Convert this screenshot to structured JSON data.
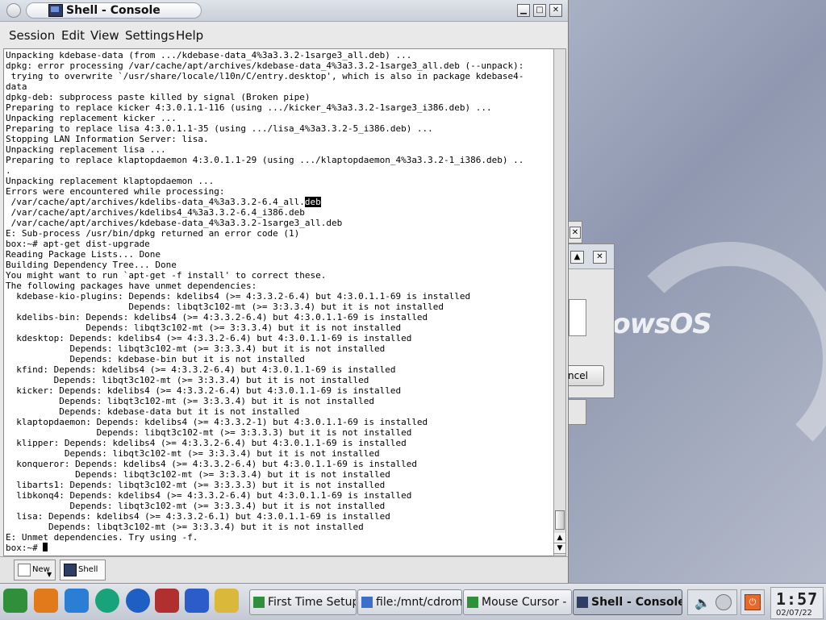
{
  "window": {
    "title": "Shell - Console",
    "controls": {
      "minimize": "▁",
      "maximize": "□",
      "close": "✕"
    }
  },
  "menu": [
    "Session",
    "Edit",
    "View",
    "Settings",
    "Help"
  ],
  "terminal": {
    "lines": [
      "Unpacking kdebase-data (from .../kdebase-data_4%3a3.3.2-1sarge3_all.deb) ...",
      "dpkg: error processing /var/cache/apt/archives/kdebase-data_4%3a3.3.2-1sarge3_all.deb (--unpack):",
      " trying to overwrite `/usr/share/locale/l10n/C/entry.desktop', which is also in package kdebase4-",
      "data",
      "dpkg-deb: subprocess paste killed by signal (Broken pipe)",
      "Preparing to replace kicker 4:3.0.1.1-116 (using .../kicker_4%3a3.3.2-1sarge3_i386.deb) ...",
      "Unpacking replacement kicker ...",
      "Preparing to replace lisa 4:3.0.1.1-35 (using .../lisa_4%3a3.3.2-5_i386.deb) ...",
      "Stopping LAN Information Server: lisa.",
      "Unpacking replacement lisa ...",
      "Preparing to replace klaptopdaemon 4:3.0.1.1-29 (using .../klaptopdaemon_4%3a3.3.2-1_i386.deb) ..",
      ".",
      "Unpacking replacement klaptopdaemon ...",
      "Errors were encountered while processing:",
      " /var/cache/apt/archives/kdelibs-data_4%3a3.3.2-6.4_all.",
      " /var/cache/apt/archives/kdelibs4_4%3a3.3.2-6.4_i386.deb",
      " /var/cache/apt/archives/kdebase-data_4%3a3.3.2-1sarge3_all.deb",
      "E: Sub-process /usr/bin/dpkg returned an error code (1)",
      "box:~# apt-get dist-upgrade",
      "Reading Package Lists... Done",
      "Building Dependency Tree... Done",
      "You might want to run `apt-get -f install' to correct these.",
      "The following packages have unmet dependencies:",
      "  kdebase-kio-plugins: Depends: kdelibs4 (>= 4:3.3.2-6.4) but 4:3.0.1.1-69 is installed",
      "                       Depends: libqt3c102-mt (>= 3:3.3.4) but it is not installed",
      "  kdelibs-bin: Depends: kdelibs4 (>= 4:3.3.2-6.4) but 4:3.0.1.1-69 is installed",
      "               Depends: libqt3c102-mt (>= 3:3.3.4) but it is not installed",
      "  kdesktop: Depends: kdelibs4 (>= 4:3.3.2-6.4) but 4:3.0.1.1-69 is installed",
      "            Depends: libqt3c102-mt (>= 3:3.3.4) but it is not installed",
      "            Depends: kdebase-bin but it is not installed",
      "  kfind: Depends: kdelibs4 (>= 4:3.3.2-6.4) but 4:3.0.1.1-69 is installed",
      "         Depends: libqt3c102-mt (>= 3:3.3.4) but it is not installed",
      "  kicker: Depends: kdelibs4 (>= 4:3.3.2-6.4) but 4:3.0.1.1-69 is installed",
      "          Depends: libqt3c102-mt (>= 3:3.3.4) but it is not installed",
      "          Depends: kdebase-data but it is not installed",
      "  klaptopdaemon: Depends: kdelibs4 (>= 4:3.3.2-1) but 4:3.0.1.1-69 is installed",
      "                 Depends: libqt3c102-mt (>= 3:3.3.3) but it is not installed",
      "  klipper: Depends: kdelibs4 (>= 4:3.3.2-6.4) but 4:3.0.1.1-69 is installed",
      "           Depends: libqt3c102-mt (>= 3:3.3.4) but it is not installed",
      "  konqueror: Depends: kdelibs4 (>= 4:3.3.2-6.4) but 4:3.0.1.1-69 is installed",
      "             Depends: libqt3c102-mt (>= 3:3.3.4) but it is not installed",
      "  libarts1: Depends: libqt3c102-mt (>= 3:3.3.3) but it is not installed",
      "  libkonq4: Depends: kdelibs4 (>= 4:3.3.2-6.4) but 4:3.0.1.1-69 is installed",
      "            Depends: libqt3c102-mt (>= 3:3.3.4) but it is not installed",
      "  lisa: Depends: kdelibs4 (>= 4:3.3.2-6.1) but 4:3.0.1.1-69 is installed",
      "        Depends: libqt3c102-mt (>= 3:3.3.4) but it is not installed",
      "E: Unmet dependencies. Try using -f.",
      "box:~# "
    ],
    "highlight": "deb"
  },
  "tabs": {
    "new": "New",
    "shell": "Shell"
  },
  "taskbar": {
    "tasks": [
      "First Time Setup",
      "file:/mnt/cdrom1",
      "Mouse Cursor -",
      "Shell - Console"
    ],
    "clock_time": "1:57",
    "clock_date": "02/07/22"
  },
  "desktop": {
    "wallpaper_text": "dowsOS",
    "dialog_cancel": "ncel"
  },
  "colors": {
    "accent": "#2e3d66",
    "terminal_bg": "#ffffff"
  }
}
